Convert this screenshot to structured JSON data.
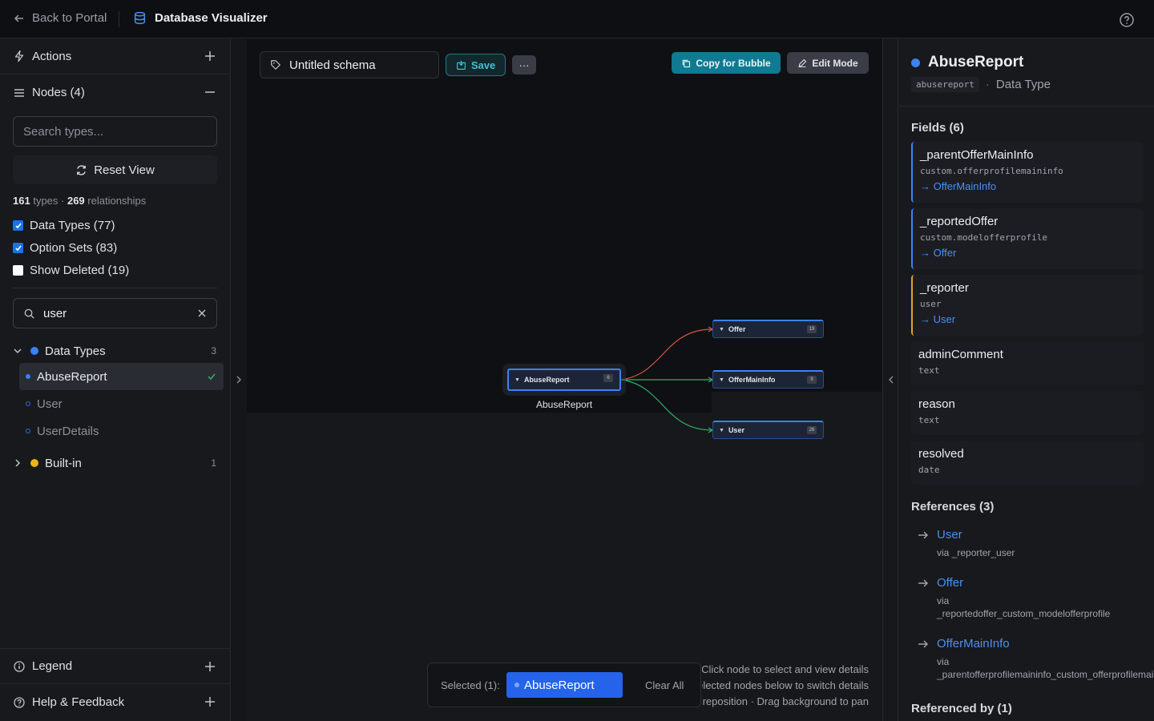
{
  "topbar": {
    "back_label": "Back to Portal",
    "app_title": "Database Visualizer"
  },
  "sidebar": {
    "actions_label": "Actions",
    "nodes_label": "Nodes (4)",
    "search_placeholder": "Search types...",
    "reset_label": "Reset View",
    "stats": {
      "types_count": "161",
      "types_label": "types ·",
      "rel_count": "269",
      "rel_label": "relationships"
    },
    "checkboxes": [
      {
        "label": "Data Types (77)",
        "checked": true
      },
      {
        "label": "Option Sets (83)",
        "checked": true
      },
      {
        "label": "Show Deleted (19)",
        "checked": false
      }
    ],
    "filter_value": "user",
    "groups": [
      {
        "label": "Data Types",
        "count": "3",
        "color": "#3b82f6",
        "expanded": true,
        "items": [
          "AbuseReport",
          "User",
          "UserDetails"
        ]
      },
      {
        "label": "Built-in",
        "count": "1",
        "color": "#e8b416",
        "expanded": false
      }
    ],
    "legend_label": "Legend",
    "help_label": "Help & Feedback"
  },
  "canvas": {
    "schema_name": "Untitled schema",
    "save_label": "Save",
    "more_label": "···",
    "copy_label": "Copy for Bubble",
    "edit_label": "Edit Mode",
    "nodes": [
      {
        "name": "AbuseReport",
        "count": "6"
      },
      {
        "name": "Offer",
        "count": "19"
      },
      {
        "name": "OfferMainInfo",
        "count": "9"
      },
      {
        "name": "User",
        "count": "26"
      }
    ],
    "main_node_label": "AbuseReport",
    "edge_colors": {
      "offer": "#e0533f",
      "offermaininfo": "#2db36b",
      "user": "#2db36b"
    },
    "selection": {
      "label": "Selected (1):",
      "chip": "AbuseReport",
      "clear": "Clear All"
    },
    "hints": [
      "Click node to select and view details",
      "Click selected nodes below to switch details",
      "Drag nodes to reposition · Drag background to pan"
    ]
  },
  "details": {
    "title": "AbuseReport",
    "code": "abusereport",
    "type": "Data Type",
    "fields_header": "Fields (6)",
    "fields": [
      {
        "name": "_parentOfferMainInfo",
        "type": "custom.offerprofilemaininfo",
        "link": "→ OfferMainInfo",
        "accent": "blue"
      },
      {
        "name": "_reportedOffer",
        "type": "custom.modelofferprofile",
        "link": "→ Offer",
        "accent": "blue"
      },
      {
        "name": "_reporter",
        "type": "user",
        "link": "→ User",
        "accent": "yellow"
      },
      {
        "name": "adminComment",
        "type": "text"
      },
      {
        "name": "reason",
        "type": "text"
      },
      {
        "name": "resolved",
        "type": "date"
      }
    ],
    "references_header": "References (3)",
    "references": [
      {
        "name": "User",
        "via": [
          "via _reporter_user"
        ]
      },
      {
        "name": "Offer",
        "via": [
          "via",
          "_reportedoffer_custom_modelofferprofile"
        ]
      },
      {
        "name": "OfferMainInfo",
        "via": [
          "via",
          "_parentofferprofilemaininfo_custom_offerprofilemaininfo"
        ]
      }
    ],
    "referenced_by_header": "Referenced by (1)"
  },
  "colors": {
    "accent": "#3b82f6",
    "teal": "#0f7a92",
    "builtin": "#e8b416"
  }
}
